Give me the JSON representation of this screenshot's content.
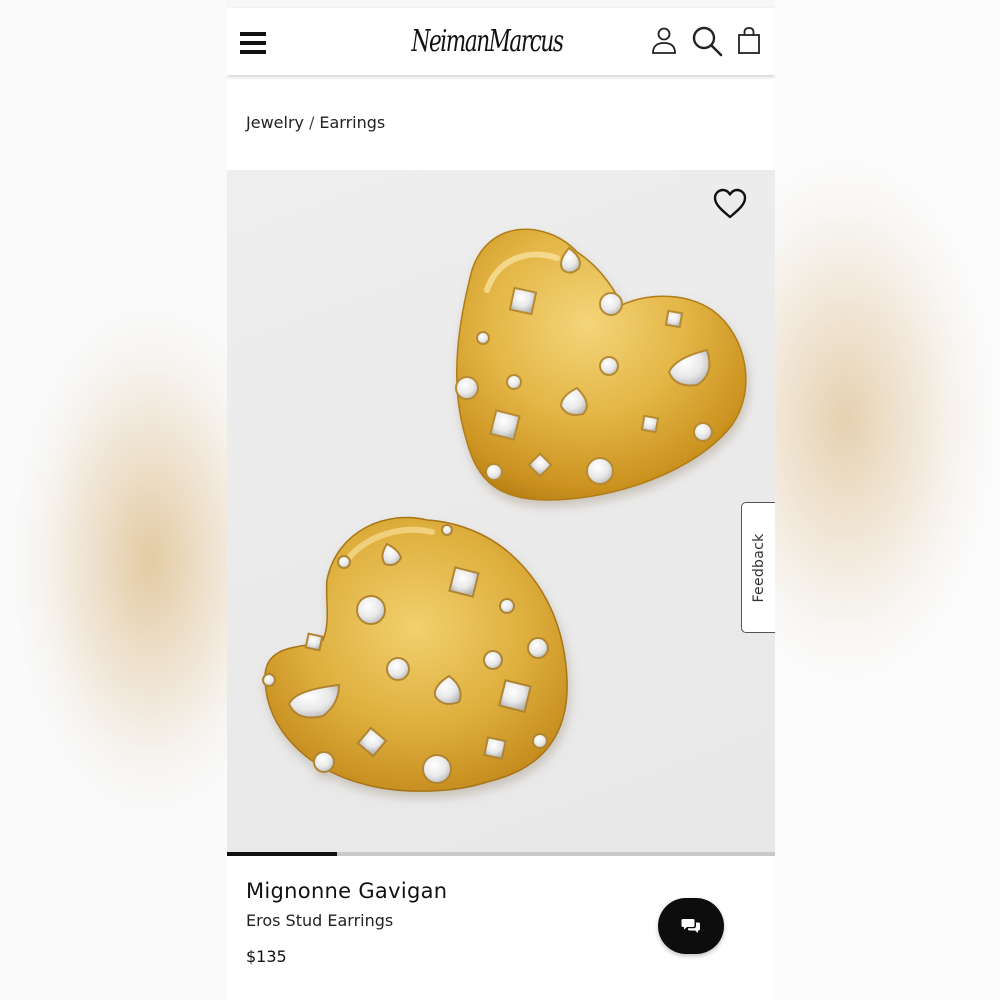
{
  "header": {
    "brand": "NeimanMarcus",
    "icons": [
      "menu-icon",
      "account-icon",
      "search-icon",
      "bag-icon"
    ]
  },
  "breadcrumb": {
    "items": [
      "Jewelry",
      "Earrings"
    ],
    "separator": "/"
  },
  "product_image": {
    "alt_subject": "gold heart stud earrings with crystals",
    "carousel_progress": 0.2
  },
  "feedback": {
    "label": "Feedback"
  },
  "product": {
    "designer": "Mignonne Gavigan",
    "name": "Eros Stud Earrings",
    "price": "$135"
  },
  "colors": {
    "accent": "#111111",
    "gold": "#d6a22c",
    "image_bg": "#ebebeb"
  }
}
